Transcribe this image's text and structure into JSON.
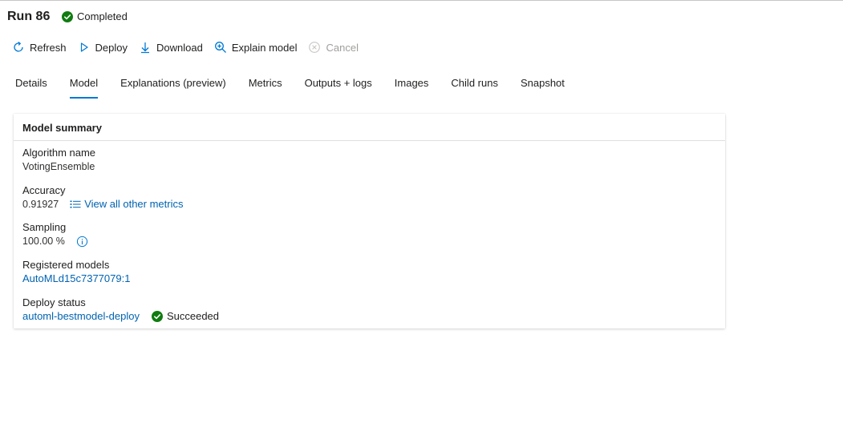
{
  "header": {
    "title": "Run 86",
    "status": "Completed",
    "status_color": "#107c10"
  },
  "toolbar": {
    "refresh": "Refresh",
    "deploy": "Deploy",
    "download": "Download",
    "explain": "Explain model",
    "cancel": "Cancel"
  },
  "tabs": [
    {
      "label": "Details"
    },
    {
      "label": "Model"
    },
    {
      "label": "Explanations (preview)"
    },
    {
      "label": "Metrics"
    },
    {
      "label": "Outputs + logs"
    },
    {
      "label": "Images"
    },
    {
      "label": "Child runs"
    },
    {
      "label": "Snapshot"
    }
  ],
  "active_tab": "Model",
  "accent_color": "#0078d4",
  "summary": {
    "title": "Model summary",
    "algorithm_label": "Algorithm name",
    "algorithm_value": "VotingEnsemble",
    "accuracy_label": "Accuracy",
    "accuracy_value": "0.91927",
    "metrics_link": "View all other metrics",
    "sampling_label": "Sampling",
    "sampling_value": "100.00 %",
    "registered_label": "Registered models",
    "registered_value": "AutoMLd15c7377079:1",
    "deploy_label": "Deploy status",
    "deploy_value": "automl-bestmodel-deploy",
    "deploy_status": "Succeeded"
  }
}
